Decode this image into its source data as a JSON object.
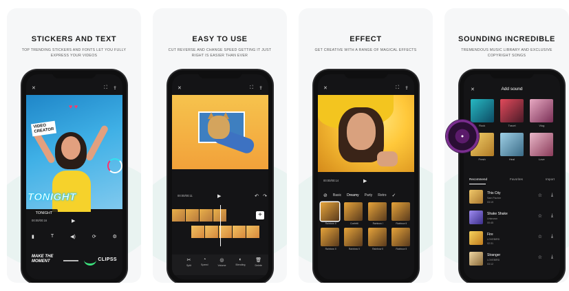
{
  "panels": [
    {
      "heading": "STICKERS AND TEXT",
      "sub": "TOP TRENDING STICKERS AND FONTS LET YOU FULLY EXPRESS YOUR VIDEOS",
      "phone": {
        "video_creator": "VIDEO\nCREATOR",
        "tonight_big": "TONIGHT",
        "tonight_chip": "TONIGHT",
        "time": "00:00/00:16",
        "moment": "MAKE THE\nMOMENT",
        "clips": "CLIPSS"
      }
    },
    {
      "heading": "EASY TO USE",
      "sub": "CUT REVERSE AND CHANGE SPEED GETTING IT JUST RIGHT IS EASIER THAN EVER",
      "phone": {
        "time": "00:00/00:11",
        "tools": [
          "Split",
          "Speed",
          "Volume",
          "Blending",
          "Delete"
        ]
      }
    },
    {
      "heading": "EFFECT",
      "sub": "GET CREATIVE WITH A RANGE OF MAGICAL EFFECTS",
      "phone": {
        "time": "00:00/00:14",
        "tabs": [
          "Basic",
          "Dreamy",
          "Party",
          "Retro"
        ],
        "effects": [
          "Rainbow II",
          "Confetti",
          "Rainbow I",
          "Rainbow II",
          "Rainbow II",
          "Rainbow II",
          "Rainbow II",
          "Rainbow II"
        ]
      }
    },
    {
      "heading": "SOUNDING INCREDIBLE",
      "sub": "TREMENDOUS MUSIC LIBRARY AND EXCLUSIVE COPYRIGHT SONGS",
      "phone": {
        "title": "Add sound",
        "albums": [
          "Rock",
          "Travel",
          "Vlog",
          "Fresh",
          "Heal",
          "Love"
        ],
        "tabs": [
          "Recommend",
          "Favorites",
          "Import"
        ],
        "songs": [
          {
            "title": "This City",
            "artist": "Sam Fischer",
            "duration": "03:19"
          },
          {
            "title": "Shake Shake",
            "artist": "Unknown",
            "duration": "00:45"
          },
          {
            "title": "Fire",
            "artist": "LOVEBIRD",
            "duration": "02:31"
          },
          {
            "title": "Stranger",
            "artist": "LOVEBIRD",
            "duration": "03:12"
          }
        ]
      }
    }
  ],
  "colors": {
    "card_bg": "#f6f7f8",
    "accent_teal": "#e9f3f1",
    "phone_body": "#0f0f10",
    "highlight_cyan": "#29c6f2",
    "sticker_green": "#3be07c"
  },
  "icons": {
    "close": "close-icon",
    "fullscreen": "fullscreen-icon",
    "export": "export-icon",
    "play": "play-icon",
    "undo": "undo-icon",
    "redo": "redo-icon",
    "add": "add-icon",
    "star": "star-icon",
    "download": "download-icon",
    "confirm": "check-icon"
  }
}
